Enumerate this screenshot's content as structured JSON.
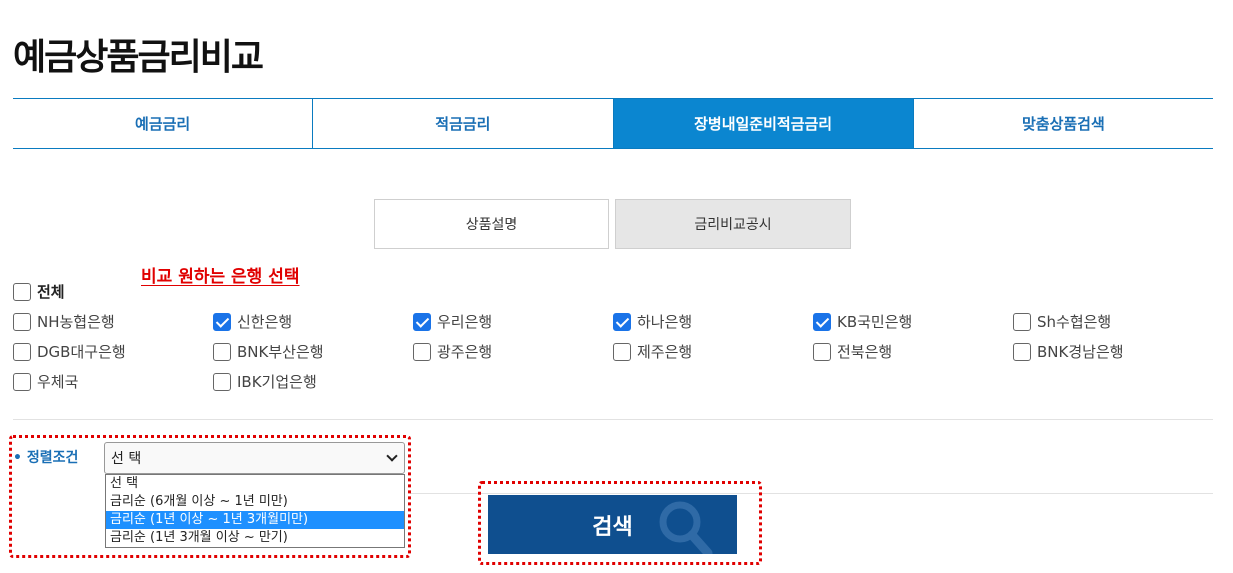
{
  "page": {
    "title": "예금상품금리비교"
  },
  "main_tabs": [
    {
      "label": "예금금리",
      "active": false
    },
    {
      "label": "적금금리",
      "active": false
    },
    {
      "label": "장병내일준비적금금리",
      "active": true
    },
    {
      "label": "맞춤상품검색",
      "active": false
    }
  ],
  "sub_tabs": [
    {
      "label": "상품설명",
      "active": false
    },
    {
      "label": "금리비교공시",
      "active": true
    }
  ],
  "annotation": "비교 원하는 은행 선택",
  "banks": {
    "all_label": "전체",
    "all_checked": false,
    "items": [
      {
        "label": "NH농협은행",
        "checked": false
      },
      {
        "label": "신한은행",
        "checked": true
      },
      {
        "label": "우리은행",
        "checked": true
      },
      {
        "label": "하나은행",
        "checked": true
      },
      {
        "label": "KB국민은행",
        "checked": true
      },
      {
        "label": "Sh수협은행",
        "checked": false
      },
      {
        "label": "DGB대구은행",
        "checked": false
      },
      {
        "label": "BNK부산은행",
        "checked": false
      },
      {
        "label": "광주은행",
        "checked": false
      },
      {
        "label": "제주은행",
        "checked": false
      },
      {
        "label": "전북은행",
        "checked": false
      },
      {
        "label": "BNK경남은행",
        "checked": false
      },
      {
        "label": "우체국",
        "checked": false
      },
      {
        "label": "IBK기업은행",
        "checked": false
      }
    ]
  },
  "sort": {
    "label": "• 정렬조건",
    "selected": "선 택",
    "options": [
      "선 택",
      "금리순 (6개월 이상 ~ 1년 미만)",
      "금리순 (1년 이상 ~ 1년 3개월미만)",
      "금리순 (1년 3개월 이상 ~ 만기)"
    ],
    "highlighted_index": 2
  },
  "search": {
    "label": "검색"
  },
  "colors": {
    "accent": "#0b86d0",
    "tab_text": "#1a6fb5",
    "button": "#0f4f8f",
    "annotation": "#e00000",
    "checkbox": "#1a73e8"
  }
}
